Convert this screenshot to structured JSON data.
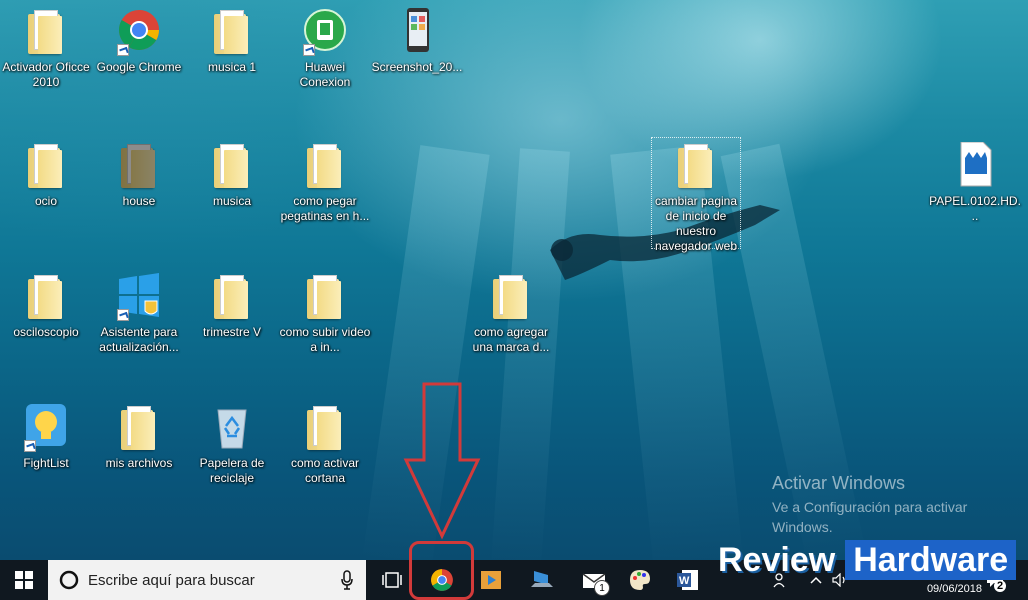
{
  "desktop": {
    "icons": [
      {
        "id": "activador",
        "label": "Activador Oficce 2010",
        "type": "folder"
      },
      {
        "id": "chrome",
        "label": "Google Chrome",
        "type": "chrome"
      },
      {
        "id": "musica1",
        "label": "musica 1",
        "type": "folder"
      },
      {
        "id": "huawei",
        "label": "Huawei Conexion",
        "type": "huawei"
      },
      {
        "id": "screenshot",
        "label": "Screenshot_20...",
        "type": "phone"
      },
      {
        "id": "ocio",
        "label": "ocio",
        "type": "folder"
      },
      {
        "id": "house",
        "label": "house",
        "type": "folder"
      },
      {
        "id": "musica",
        "label": "musica",
        "type": "folder"
      },
      {
        "id": "pegatinas",
        "label": "como pegar pegatinas en h...",
        "type": "folder"
      },
      {
        "id": "cambiar",
        "label": "cambiar pagina de inicio de nuestro navegador web",
        "type": "folder"
      },
      {
        "id": "papel",
        "label": "PAPEL.0102.HD...",
        "type": "video"
      },
      {
        "id": "osciloscopio",
        "label": "osciloscopio",
        "type": "folder"
      },
      {
        "id": "asistente",
        "label": "Asistente para actualización...",
        "type": "windows"
      },
      {
        "id": "trimestre",
        "label": "trimestre V",
        "type": "folder"
      },
      {
        "id": "subirvideo",
        "label": "como subir video a in...",
        "type": "folder"
      },
      {
        "id": "marca",
        "label": "como agregar una marca d...",
        "type": "folder"
      },
      {
        "id": "fightlist",
        "label": "FightList",
        "type": "fightlist"
      },
      {
        "id": "misarchivos",
        "label": "mis archivos",
        "type": "folder"
      },
      {
        "id": "papelera",
        "label": "Papelera de reciclaje",
        "type": "recycle"
      },
      {
        "id": "cortana",
        "label": "como activar cortana",
        "type": "folder"
      }
    ]
  },
  "activation": {
    "title": "Activar Windows",
    "subtitle": "Ve a Configuración para activar Windows."
  },
  "taskbar": {
    "search_placeholder": "Escribe aquí para buscar",
    "mail_badge": "1",
    "notification_count": "2",
    "date": "09/06/2018"
  },
  "brand": {
    "review": "Review",
    "hardware": "Hardware"
  },
  "colors": {
    "annotation": "#d23a3a",
    "taskbar": "#101820"
  }
}
